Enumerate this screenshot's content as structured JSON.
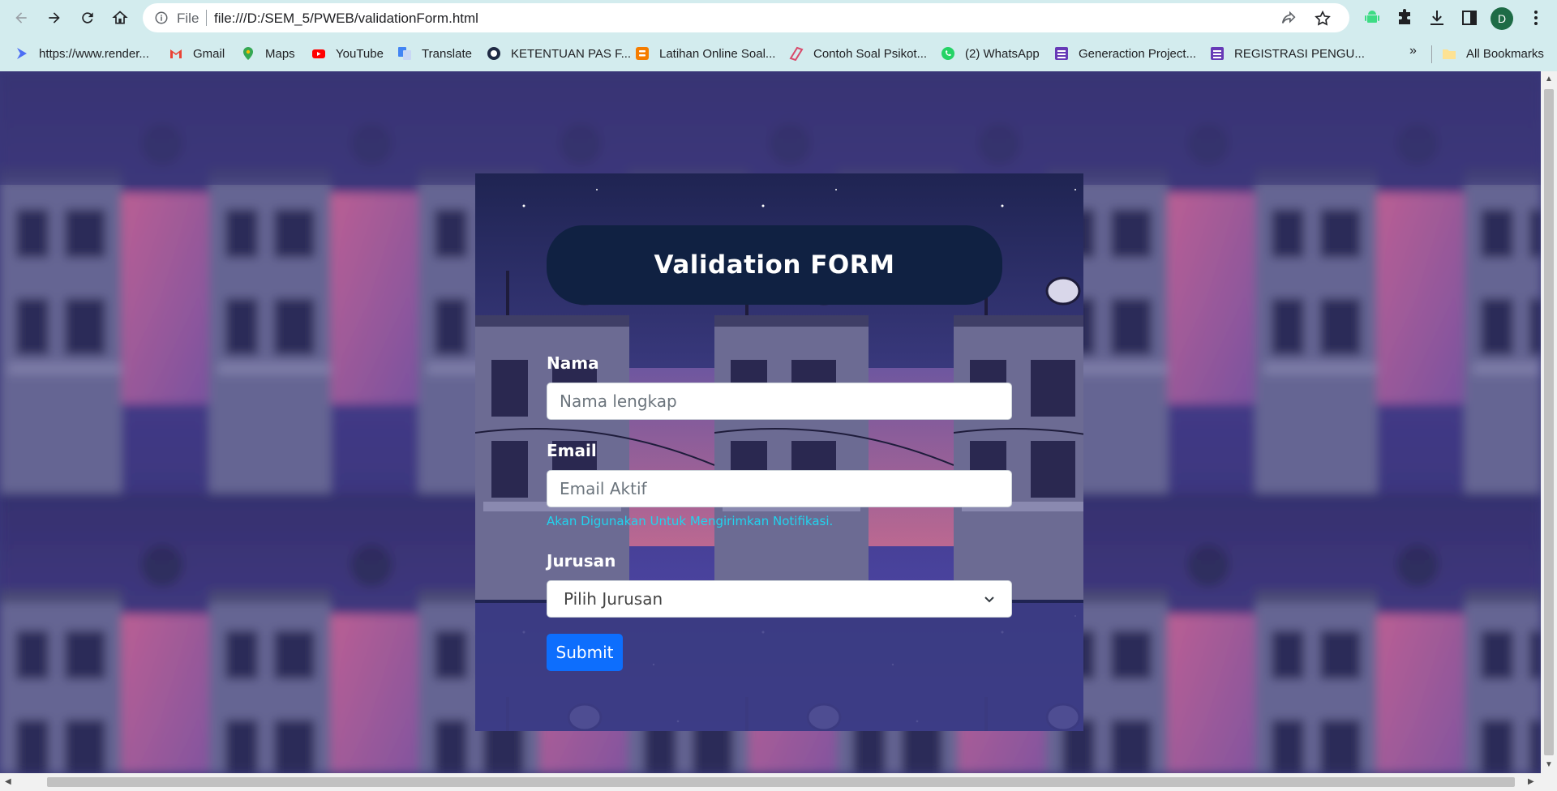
{
  "browser": {
    "omnibox": {
      "scheme_label": "File",
      "url": "file:///D:/SEM_5/PWEB/validationForm.html"
    },
    "profile_initial": "D",
    "bookmarks": [
      {
        "label": "https://www.render...",
        "icon": "render-icon"
      },
      {
        "label": "Gmail",
        "icon": "gmail-icon"
      },
      {
        "label": "Maps",
        "icon": "maps-icon"
      },
      {
        "label": "YouTube",
        "icon": "youtube-icon"
      },
      {
        "label": "Translate",
        "icon": "translate-icon"
      },
      {
        "label": "KETENTUAN PAS F...",
        "icon": "site-icon"
      },
      {
        "label": "Latihan Online Soal...",
        "icon": "blogger-icon"
      },
      {
        "label": "Contoh Soal Psikot...",
        "icon": "site-icon"
      },
      {
        "label": "(2) WhatsApp",
        "icon": "whatsapp-icon"
      },
      {
        "label": "Generaction Project...",
        "icon": "forms-icon"
      },
      {
        "label": "REGISTRASI PENGU...",
        "icon": "forms-icon"
      }
    ],
    "more_bookmarks": "»",
    "all_bookmarks": "All Bookmarks"
  },
  "form": {
    "title": "Validation FORM",
    "name_label": "Nama",
    "name_placeholder": "Nama lengkap",
    "email_label": "Email",
    "email_placeholder": "Email Aktif",
    "email_help": "Akan Digunakan Untuk Mengirimkan Notifikasi.",
    "major_label": "Jurusan",
    "major_selected": "Pilih Jurusan",
    "submit_label": "Submit"
  },
  "colors": {
    "chrome_bg": "#d3ecee",
    "header_pill": "#102142",
    "submit_button": "#0d6efd",
    "help_text": "#22d3ee"
  }
}
